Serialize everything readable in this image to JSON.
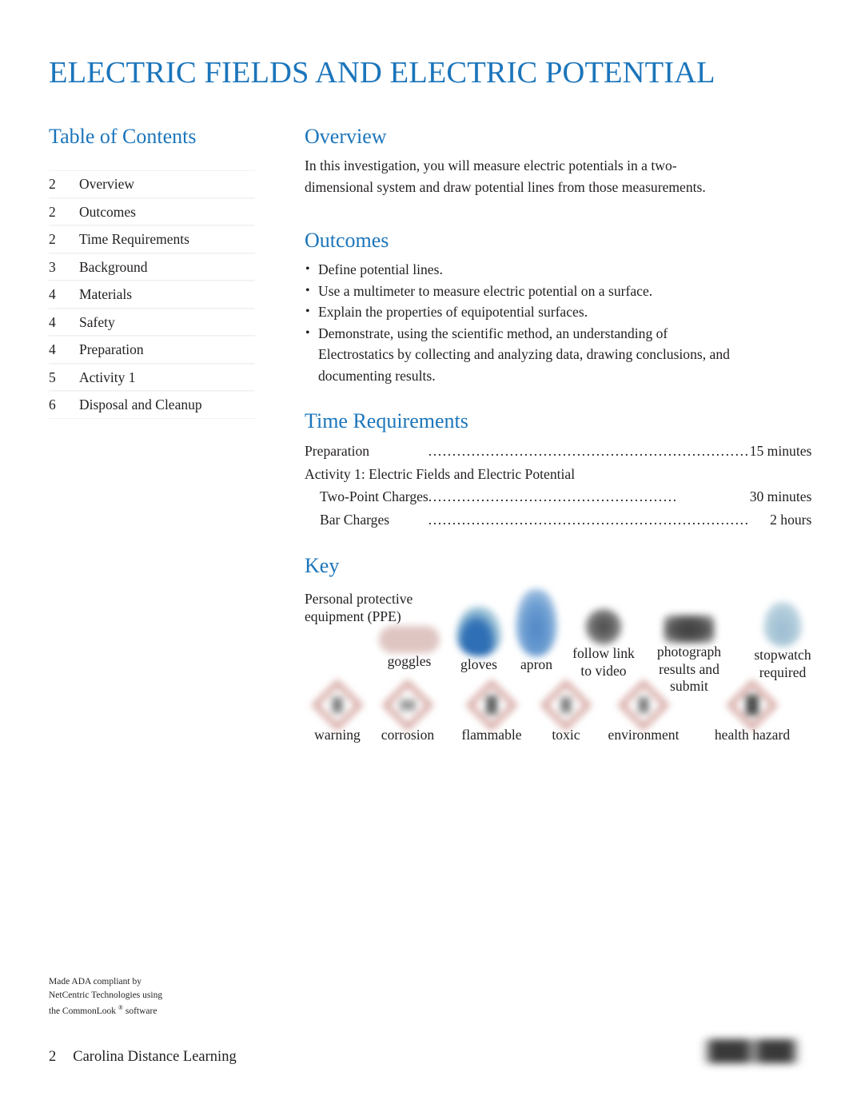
{
  "document": {
    "title": "ELECTRIC FIELDS AND ELECTRIC POTENTIAL",
    "accent_color": "#1b75bb",
    "text_color": "#231f20"
  },
  "toc": {
    "heading": "Table of Contents",
    "entries": [
      {
        "page": "2",
        "label": "Overview"
      },
      {
        "page": "2",
        "label": "Outcomes"
      },
      {
        "page": "2",
        "label": "Time Requirements"
      },
      {
        "page": "3",
        "label": "Background"
      },
      {
        "page": "4",
        "label": "Materials"
      },
      {
        "page": "4",
        "label": "Safety"
      },
      {
        "page": "4",
        "label": "Preparation"
      },
      {
        "page": "5",
        "label": "Activity 1"
      },
      {
        "page": "6",
        "label": "Disposal and Cleanup"
      }
    ]
  },
  "overview": {
    "heading": "Overview",
    "body": "In this investigation, you will measure electric potentials in a two-dimensional system and draw potential lines from those measurements."
  },
  "outcomes": {
    "heading": "Outcomes",
    "items": [
      "Define potential lines.",
      "Use a multimeter to measure electric potential on a surface.",
      "Explain the properties of equipotential surfaces.",
      "Demonstrate, using the scientific method, an understanding of Electrostatics by collecting and analyzing data, drawing conclusions, and documenting results."
    ]
  },
  "time_requirements": {
    "heading": "Time Requirements",
    "rows": [
      {
        "label": "Preparation",
        "leader": "...................................................................",
        "value": "15 minutes",
        "indent": false,
        "full_width": false
      },
      {
        "label": "Activity 1: Electric Fields and Electric Potential",
        "leader": "",
        "value": "",
        "indent": false,
        "full_width": true
      },
      {
        "label": "Two-Point Charges",
        "leader": "....................................................",
        "value": "30 minutes",
        "indent": true,
        "full_width": false
      },
      {
        "label": "Bar Charges",
        "leader": "...................................................................",
        "value": "2 hours",
        "indent": true,
        "full_width": false
      }
    ]
  },
  "key": {
    "heading": "Key",
    "ppe_label": "Personal protective equipment (PPE)",
    "ppe_items": [
      {
        "label": "goggles",
        "icon": "goggles-icon"
      },
      {
        "label": "gloves",
        "icon": "gloves-icon"
      },
      {
        "label": "apron",
        "icon": "apron-icon"
      }
    ],
    "action_items": [
      {
        "label": "follow link to video",
        "icon": "video-link-icon"
      },
      {
        "label": "photograph results and submit",
        "icon": "camera-icon"
      },
      {
        "label": "stopwatch required",
        "icon": "stopwatch-icon"
      }
    ],
    "hazard_items": [
      {
        "label": "warning",
        "icon": "ghs-warning-icon"
      },
      {
        "label": "corrosion",
        "icon": "ghs-corrosion-icon"
      },
      {
        "label": "flammable",
        "icon": "ghs-flammable-icon"
      },
      {
        "label": "toxic",
        "icon": "ghs-toxic-icon"
      },
      {
        "label": "environment",
        "icon": "ghs-environment-icon"
      },
      {
        "label": "health hazard",
        "icon": "ghs-health-hazard-icon"
      }
    ]
  },
  "footer": {
    "ada_line1": "Made ADA compliant by",
    "ada_line2": "NetCentric Technologies using",
    "ada_line3_pre": "the CommonLook",
    "ada_reg": "®",
    "ada_line3_post": "software",
    "page_number": "2",
    "organization": "Carolina Distance Learning"
  }
}
